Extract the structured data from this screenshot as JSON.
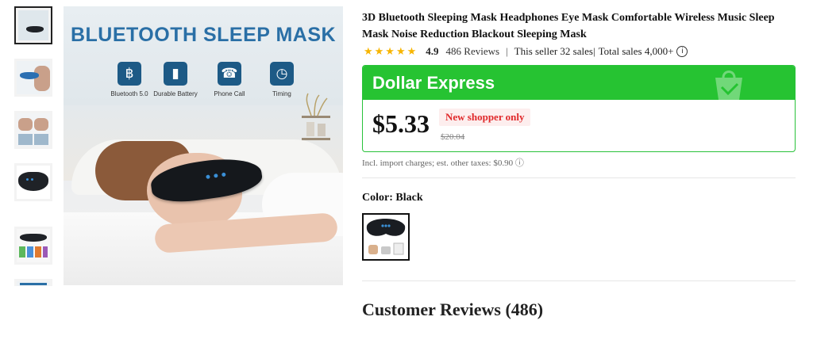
{
  "gallery": {
    "main_image": {
      "title": "BLUETOOTH SLEEP MASK",
      "features": [
        {
          "icon": "bluetooth-icon",
          "glyph": "฿",
          "label": "Bluetooth 5.0"
        },
        {
          "icon": "battery-icon",
          "glyph": "▮",
          "label": "Durable Battery"
        },
        {
          "icon": "phone-call-icon",
          "glyph": "☎",
          "label": "Phone Call"
        },
        {
          "icon": "timing-icon",
          "glyph": "◷",
          "label": "Timing"
        }
      ]
    },
    "thumbnail_count": 6,
    "selected_thumbnail": 1
  },
  "product": {
    "title": "3D Bluetooth Sleeping Mask Headphones Eye Mask Comfortable Wireless Music Sleep Mask Noise Reduction Blackout Sleeping Mask",
    "stars": "★★★★★",
    "rating": "4.9",
    "reviews": "486 Reviews",
    "separator": "|",
    "seller_sales": "This seller 32 sales|",
    "total_sales": "Total sales 4,000+",
    "info_glyph": "i"
  },
  "deal": {
    "name": "Dollar Express",
    "price": "$5.33",
    "badge": "New shopper only",
    "original_price": "$20.04",
    "accent_color": "#26c332"
  },
  "tax_note": "Incl. import charges; est. other taxes: $0.90 ⓘ",
  "color": {
    "label": "Color: Black",
    "selected": "Black"
  },
  "reviews_section": {
    "heading": "Customer Reviews (486)"
  }
}
